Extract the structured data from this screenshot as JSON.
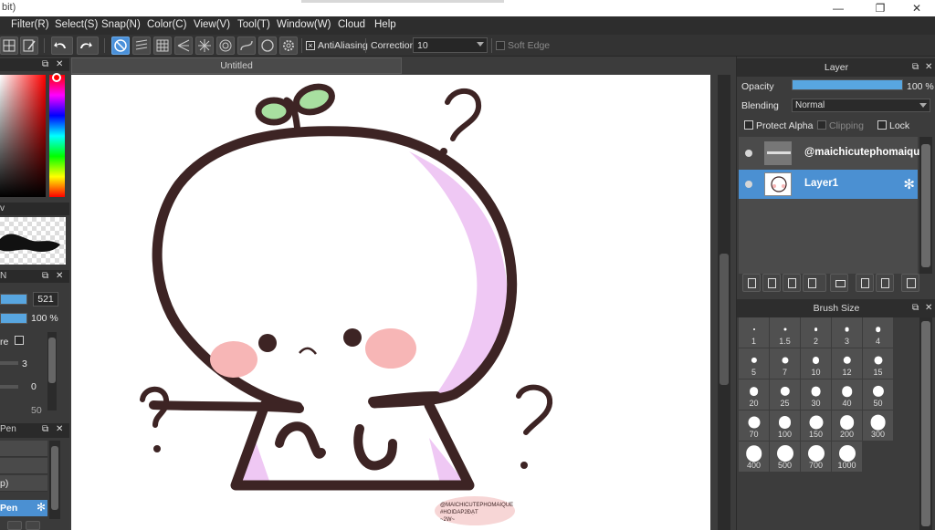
{
  "window": {
    "title": "bit)",
    "minimize": "—",
    "restore": "❐",
    "close": "✕"
  },
  "menu": [
    "Filter(R)",
    "Select(S)",
    "Snap(N)",
    "Color(C)",
    "View(V)",
    "Tool(T)",
    "Window(W)",
    "Cloud",
    "Help"
  ],
  "toolbar": {
    "antialiasing_label": "AntiAliasing",
    "correction_label": "Correction",
    "correction_value": "10",
    "soft_edge_label": "Soft Edge"
  },
  "left_panel": {
    "size_value": "521",
    "opacity_value": "100 %",
    "row_a_label": "re",
    "row_b_value": "3",
    "row_c_value": "0",
    "row_d_value": "50",
    "brush_panel_label": "Pen",
    "brush_item_paren": "p)",
    "brush_selected": "Pen"
  },
  "canvas": {
    "tab_label": "Untitled",
    "watermark_line1": "@MAICHICUTEPHOMAIQUE",
    "watermark_line2": "#HOIDAP2ĐẠT",
    "watermark_line3": "~2W~"
  },
  "layer_panel": {
    "title": "Layer",
    "opacity_label": "Opacity",
    "opacity_value": "100 %",
    "opacity_fraction": 1.0,
    "blending_label": "Blending",
    "blending_value": "Normal",
    "protect_alpha_label": "Protect Alpha",
    "clipping_label": "Clipping",
    "lock_label": "Lock",
    "layers": [
      {
        "name": "@maichicutephomaique",
        "selected": false
      },
      {
        "name": "Layer1",
        "selected": true
      }
    ]
  },
  "brush_size_panel": {
    "title": "Brush Size",
    "sizes": [
      "1",
      "1.5",
      "2",
      "3",
      "4",
      "5",
      "7",
      "10",
      "12",
      "15",
      "20",
      "25",
      "30",
      "40",
      "50",
      "70",
      "100",
      "150",
      "200",
      "300",
      "400",
      "500",
      "700",
      "1000"
    ]
  },
  "colors": {
    "accent": "#4a90d9",
    "outline": "#3d2424",
    "blush": "#f7b6b6",
    "leaf": "#a8e0a0",
    "shadow": "#efc8f4"
  }
}
